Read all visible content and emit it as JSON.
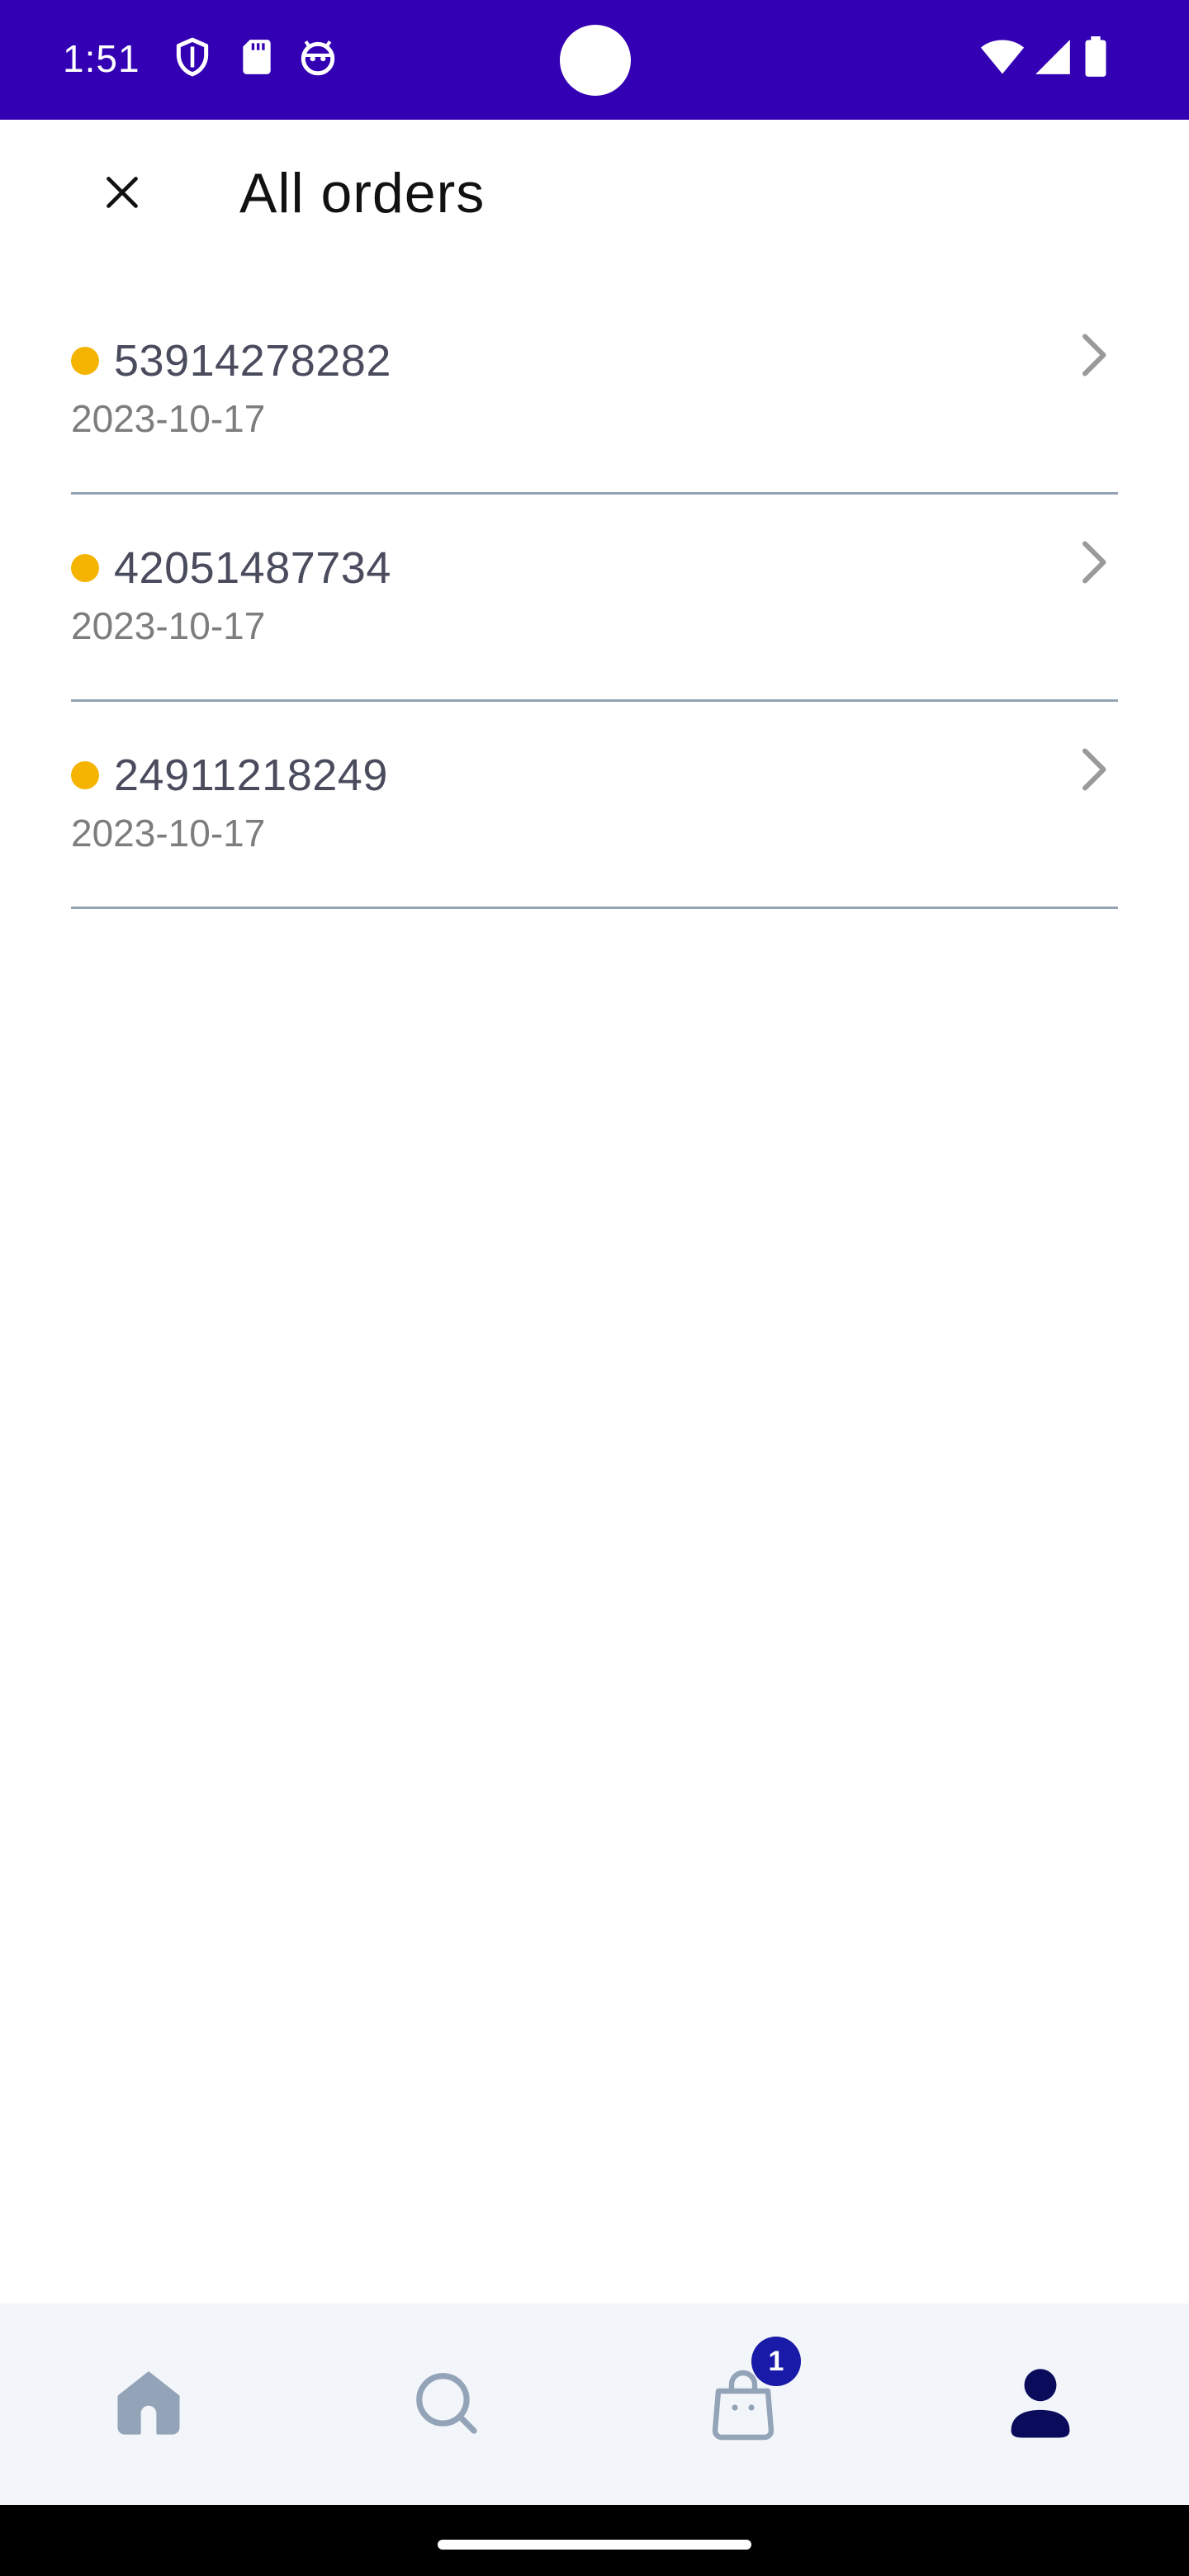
{
  "status_bar": {
    "time": "1:51",
    "left_icons": [
      "shield-icon",
      "sd-card-icon",
      "android-face-icon"
    ],
    "right_icons": [
      "wifi-icon",
      "cellular-signal-icon",
      "battery-icon"
    ]
  },
  "header": {
    "title": "All orders",
    "close_icon": "close-icon"
  },
  "orders": [
    {
      "number": "53914278282",
      "date": "2023-10-17",
      "status_color": "#f4b400"
    },
    {
      "number": "42051487734",
      "date": "2023-10-17",
      "status_color": "#f4b400"
    },
    {
      "number": "24911218249",
      "date": "2023-10-17",
      "status_color": "#f4b400"
    }
  ],
  "bottom_nav": {
    "items": [
      {
        "name": "home",
        "icon": "home-icon",
        "active": false
      },
      {
        "name": "search",
        "icon": "search-icon",
        "active": false
      },
      {
        "name": "cart",
        "icon": "shopping-bag-icon",
        "active": false,
        "badge": "1"
      },
      {
        "name": "profile",
        "icon": "user-icon",
        "active": true
      }
    ]
  },
  "colors": {
    "status_bar": "#3300b3",
    "accent": "#1a1aa8",
    "nav_inactive": "#93a3b8",
    "nav_active": "#0b0b5c",
    "divider": "#93a3b3",
    "status_dot": "#f4b400"
  }
}
